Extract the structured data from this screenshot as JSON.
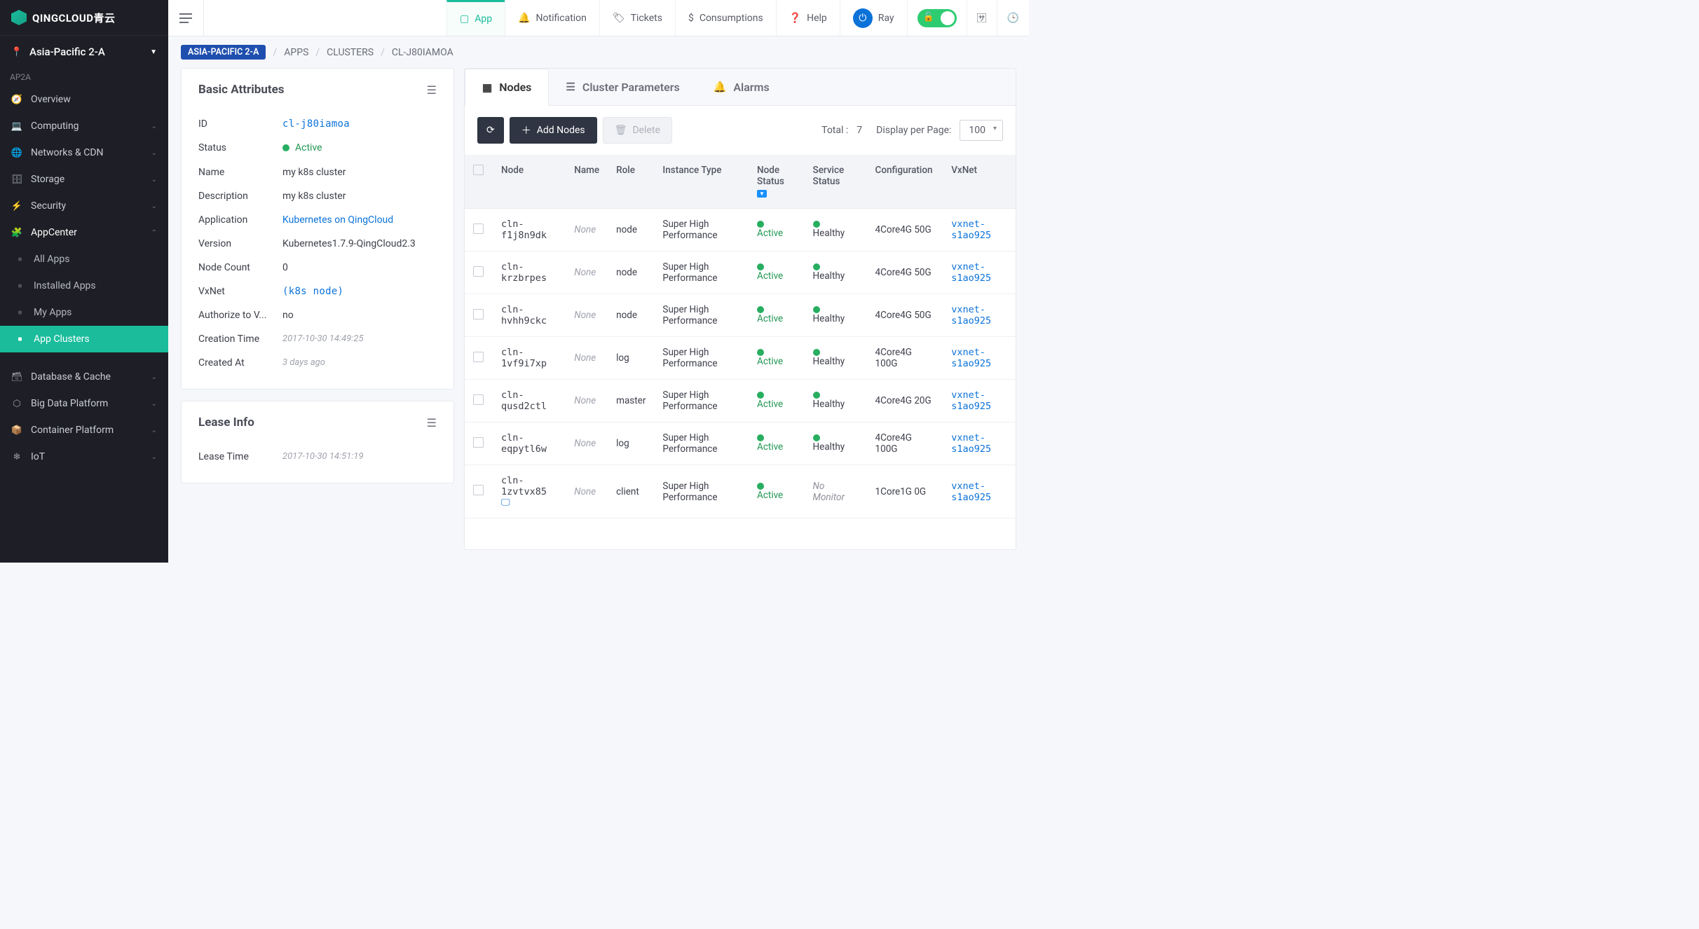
{
  "brand": "QINGCLOUD青云",
  "region": {
    "label": "Asia-Pacific 2-A",
    "zone": "AP2A"
  },
  "topnav": {
    "app": "App",
    "notification": "Notification",
    "tickets": "Tickets",
    "consumptions": "Consumptions",
    "help": "Help",
    "user": "Ray"
  },
  "sidenav": {
    "overview": "Overview",
    "computing": "Computing",
    "networks": "Networks & CDN",
    "storage": "Storage",
    "security": "Security",
    "appcenter": "AppCenter",
    "appcenter_children": [
      "All Apps",
      "Installed Apps",
      "My Apps",
      "App Clusters"
    ],
    "database": "Database & Cache",
    "bigdata": "Big Data Platform",
    "container": "Container Platform",
    "iot": "IoT"
  },
  "breadcrumbs": [
    "ASIA-PACIFIC 2-A",
    "APPS",
    "CLUSTERS",
    "CL-J80IAMOA"
  ],
  "basic": {
    "card_title": "Basic Attributes",
    "rows": {
      "id": {
        "label": "ID",
        "value": "cl-j80iamoa"
      },
      "status": {
        "label": "Status",
        "value": "Active"
      },
      "name": {
        "label": "Name",
        "value": "my k8s cluster"
      },
      "description": {
        "label": "Description",
        "value": "my k8s cluster"
      },
      "application": {
        "label": "Application",
        "value": "Kubernetes on QingCloud"
      },
      "version": {
        "label": "Version",
        "value": "Kubernetes1.7.9-QingCloud2.3"
      },
      "node_count": {
        "label": "Node Count",
        "value": "0"
      },
      "vxnet": {
        "label": "VxNet",
        "value": "(k8s node)"
      },
      "authorize": {
        "label": "Authorize to V...",
        "value": "no"
      },
      "creation_time": {
        "label": "Creation Time",
        "value": "2017-10-30 14:49:25"
      },
      "created_at": {
        "label": "Created At",
        "value": "3 days ago"
      }
    }
  },
  "lease": {
    "card_title": "Lease Info",
    "rows": {
      "lease_time": {
        "label": "Lease Time",
        "value": "2017-10-30 14:51:19"
      }
    }
  },
  "right_tabs": {
    "nodes": "Nodes",
    "params": "Cluster Parameters",
    "alarms": "Alarms"
  },
  "toolbar": {
    "add": "Add Nodes",
    "delete": "Delete",
    "total_label": "Total :",
    "total_value": "7",
    "perpage_label": "Display per Page:",
    "perpage_value": "100"
  },
  "columns": [
    "Node",
    "Name",
    "Role",
    "Instance Type",
    "Node Status",
    "Service Status",
    "Configuration",
    "VxNet"
  ],
  "rows": [
    {
      "node": "cln-f1j8n9dk",
      "name": "None",
      "role": "node",
      "itype": "Super High Performance",
      "nstatus": "Active",
      "sstatus": "Healthy",
      "config": "4Core4G 50G",
      "vxnet": "vxnet-s1ao925"
    },
    {
      "node": "cln-krzbrpes",
      "name": "None",
      "role": "node",
      "itype": "Super High Performance",
      "nstatus": "Active",
      "sstatus": "Healthy",
      "config": "4Core4G 50G",
      "vxnet": "vxnet-s1ao925"
    },
    {
      "node": "cln-hvhh9ckc",
      "name": "None",
      "role": "node",
      "itype": "Super High Performance",
      "nstatus": "Active",
      "sstatus": "Healthy",
      "config": "4Core4G 50G",
      "vxnet": "vxnet-s1ao925"
    },
    {
      "node": "cln-1vf9i7xp",
      "name": "None",
      "role": "log",
      "itype": "Super High Performance",
      "nstatus": "Active",
      "sstatus": "Healthy",
      "config": "4Core4G 100G",
      "vxnet": "vxnet-s1ao925"
    },
    {
      "node": "cln-qusd2ctl",
      "name": "None",
      "role": "master",
      "itype": "Super High Performance",
      "nstatus": "Active",
      "sstatus": "Healthy",
      "config": "4Core4G 20G",
      "vxnet": "vxnet-s1ao925"
    },
    {
      "node": "cln-eqpytl6w",
      "name": "None",
      "role": "log",
      "itype": "Super High Performance",
      "nstatus": "Active",
      "sstatus": "Healthy",
      "config": "4Core4G 100G",
      "vxnet": "vxnet-s1ao925"
    },
    {
      "node": "cln-1zvtvx85",
      "name": "None",
      "role": "client",
      "itype": "Super High Performance",
      "nstatus": "Active",
      "sstatus": "No Monitor",
      "config": "1Core1G 0G",
      "vxnet": "vxnet-s1ao925",
      "has_screen": true
    }
  ]
}
